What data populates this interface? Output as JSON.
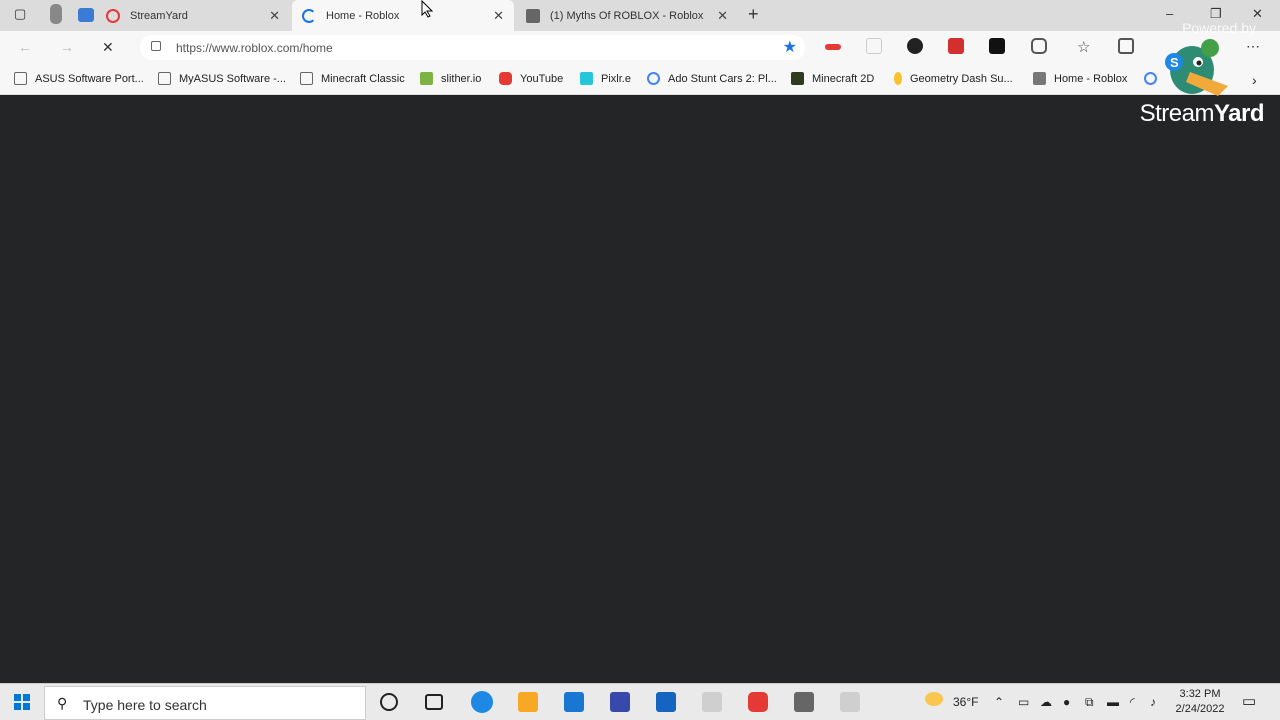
{
  "tabs": [
    {
      "label": "StreamYard",
      "active": false
    },
    {
      "label": "Home - Roblox",
      "active": true
    },
    {
      "label": "(1) Myths Of ROBLOX - Roblox",
      "active": false
    }
  ],
  "address": {
    "url": "https://www.roblox.com/home"
  },
  "bookmarks": [
    {
      "label": "ASUS Software Port..."
    },
    {
      "label": "MyASUS Software -..."
    },
    {
      "label": "Minecraft Classic"
    },
    {
      "label": "slither.io"
    },
    {
      "label": "YouTube"
    },
    {
      "label": "Pixlr.e"
    },
    {
      "label": "Ado Stunt Cars 2: Pl..."
    },
    {
      "label": "Minecraft 2D"
    },
    {
      "label": "Geometry Dash Su..."
    },
    {
      "label": "Home - Roblox"
    }
  ],
  "overlay": {
    "powered_by": "Powered by",
    "brand_light": "Stream",
    "brand_bold": "Yard"
  },
  "taskbar": {
    "search_placeholder": "Type here to search",
    "weather": "36°F",
    "time": "3:32 PM",
    "date": "2/24/2022"
  },
  "colors": {
    "accent": "#1a73e8",
    "page_bg": "#232527"
  }
}
